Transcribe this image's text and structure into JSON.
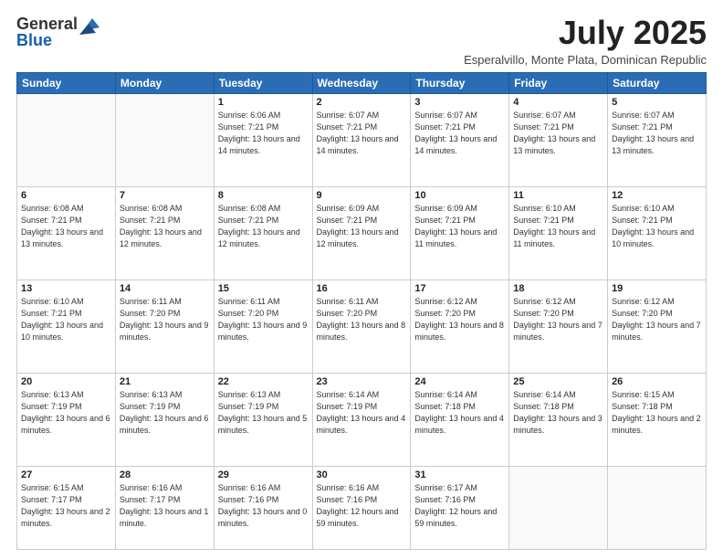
{
  "logo": {
    "line1": "General",
    "line2": "Blue"
  },
  "header": {
    "month": "July 2025",
    "location": "Esperalvillo, Monte Plata, Dominican Republic"
  },
  "weekdays": [
    "Sunday",
    "Monday",
    "Tuesday",
    "Wednesday",
    "Thursday",
    "Friday",
    "Saturday"
  ],
  "weeks": [
    [
      {
        "day": "",
        "info": ""
      },
      {
        "day": "",
        "info": ""
      },
      {
        "day": "1",
        "info": "Sunrise: 6:06 AM\nSunset: 7:21 PM\nDaylight: 13 hours\nand 14 minutes."
      },
      {
        "day": "2",
        "info": "Sunrise: 6:07 AM\nSunset: 7:21 PM\nDaylight: 13 hours\nand 14 minutes."
      },
      {
        "day": "3",
        "info": "Sunrise: 6:07 AM\nSunset: 7:21 PM\nDaylight: 13 hours\nand 14 minutes."
      },
      {
        "day": "4",
        "info": "Sunrise: 6:07 AM\nSunset: 7:21 PM\nDaylight: 13 hours\nand 13 minutes."
      },
      {
        "day": "5",
        "info": "Sunrise: 6:07 AM\nSunset: 7:21 PM\nDaylight: 13 hours\nand 13 minutes."
      }
    ],
    [
      {
        "day": "6",
        "info": "Sunrise: 6:08 AM\nSunset: 7:21 PM\nDaylight: 13 hours\nand 13 minutes."
      },
      {
        "day": "7",
        "info": "Sunrise: 6:08 AM\nSunset: 7:21 PM\nDaylight: 13 hours\nand 12 minutes."
      },
      {
        "day": "8",
        "info": "Sunrise: 6:08 AM\nSunset: 7:21 PM\nDaylight: 13 hours\nand 12 minutes."
      },
      {
        "day": "9",
        "info": "Sunrise: 6:09 AM\nSunset: 7:21 PM\nDaylight: 13 hours\nand 12 minutes."
      },
      {
        "day": "10",
        "info": "Sunrise: 6:09 AM\nSunset: 7:21 PM\nDaylight: 13 hours\nand 11 minutes."
      },
      {
        "day": "11",
        "info": "Sunrise: 6:10 AM\nSunset: 7:21 PM\nDaylight: 13 hours\nand 11 minutes."
      },
      {
        "day": "12",
        "info": "Sunrise: 6:10 AM\nSunset: 7:21 PM\nDaylight: 13 hours\nand 10 minutes."
      }
    ],
    [
      {
        "day": "13",
        "info": "Sunrise: 6:10 AM\nSunset: 7:21 PM\nDaylight: 13 hours\nand 10 minutes."
      },
      {
        "day": "14",
        "info": "Sunrise: 6:11 AM\nSunset: 7:20 PM\nDaylight: 13 hours\nand 9 minutes."
      },
      {
        "day": "15",
        "info": "Sunrise: 6:11 AM\nSunset: 7:20 PM\nDaylight: 13 hours\nand 9 minutes."
      },
      {
        "day": "16",
        "info": "Sunrise: 6:11 AM\nSunset: 7:20 PM\nDaylight: 13 hours\nand 8 minutes."
      },
      {
        "day": "17",
        "info": "Sunrise: 6:12 AM\nSunset: 7:20 PM\nDaylight: 13 hours\nand 8 minutes."
      },
      {
        "day": "18",
        "info": "Sunrise: 6:12 AM\nSunset: 7:20 PM\nDaylight: 13 hours\nand 7 minutes."
      },
      {
        "day": "19",
        "info": "Sunrise: 6:12 AM\nSunset: 7:20 PM\nDaylight: 13 hours\nand 7 minutes."
      }
    ],
    [
      {
        "day": "20",
        "info": "Sunrise: 6:13 AM\nSunset: 7:19 PM\nDaylight: 13 hours\nand 6 minutes."
      },
      {
        "day": "21",
        "info": "Sunrise: 6:13 AM\nSunset: 7:19 PM\nDaylight: 13 hours\nand 6 minutes."
      },
      {
        "day": "22",
        "info": "Sunrise: 6:13 AM\nSunset: 7:19 PM\nDaylight: 13 hours\nand 5 minutes."
      },
      {
        "day": "23",
        "info": "Sunrise: 6:14 AM\nSunset: 7:19 PM\nDaylight: 13 hours\nand 4 minutes."
      },
      {
        "day": "24",
        "info": "Sunrise: 6:14 AM\nSunset: 7:18 PM\nDaylight: 13 hours\nand 4 minutes."
      },
      {
        "day": "25",
        "info": "Sunrise: 6:14 AM\nSunset: 7:18 PM\nDaylight: 13 hours\nand 3 minutes."
      },
      {
        "day": "26",
        "info": "Sunrise: 6:15 AM\nSunset: 7:18 PM\nDaylight: 13 hours\nand 2 minutes."
      }
    ],
    [
      {
        "day": "27",
        "info": "Sunrise: 6:15 AM\nSunset: 7:17 PM\nDaylight: 13 hours\nand 2 minutes."
      },
      {
        "day": "28",
        "info": "Sunrise: 6:16 AM\nSunset: 7:17 PM\nDaylight: 13 hours\nand 1 minute."
      },
      {
        "day": "29",
        "info": "Sunrise: 6:16 AM\nSunset: 7:16 PM\nDaylight: 13 hours\nand 0 minutes."
      },
      {
        "day": "30",
        "info": "Sunrise: 6:16 AM\nSunset: 7:16 PM\nDaylight: 12 hours\nand 59 minutes."
      },
      {
        "day": "31",
        "info": "Sunrise: 6:17 AM\nSunset: 7:16 PM\nDaylight: 12 hours\nand 59 minutes."
      },
      {
        "day": "",
        "info": ""
      },
      {
        "day": "",
        "info": ""
      }
    ]
  ]
}
